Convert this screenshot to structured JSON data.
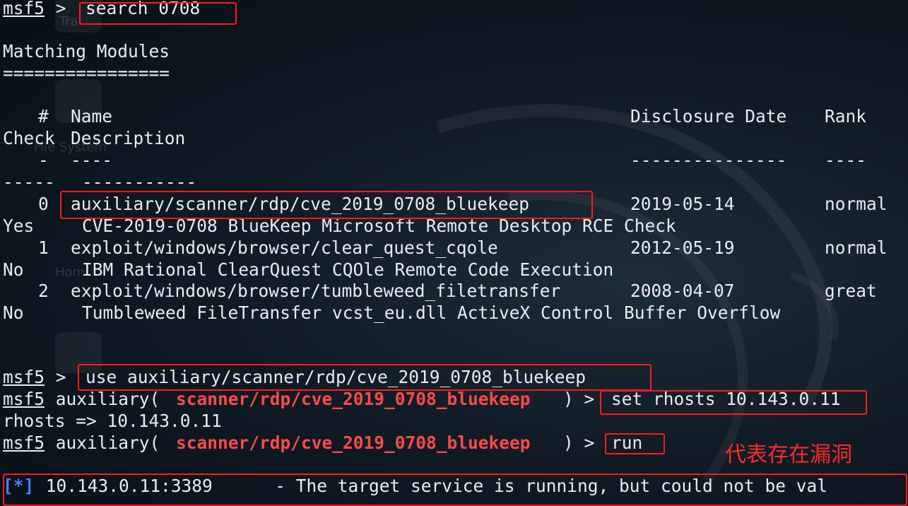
{
  "prompt": "msf5",
  "search": {
    "sep": " > ",
    "command": "search 0708"
  },
  "results": {
    "title": "Matching Modules",
    "underline": "================",
    "header_num": "#",
    "header_name": "Name",
    "header_date": "Disclosure Date",
    "header_rank": "Rank",
    "header_check": "Check",
    "header_desc": "Description",
    "dash_num": "-",
    "dash_name": "----",
    "dash_date": "---------------",
    "dash_rank": "----",
    "dash_check": "-----",
    "dash_desc": "-----------",
    "rows": [
      {
        "num": "0",
        "name": "auxiliary/scanner/rdp/cve_2019_0708_bluekeep",
        "date": "2019-05-14",
        "rank": "normal",
        "check": "Yes",
        "desc": "CVE-2019-0708 BlueKeep Microsoft Remote Desktop RCE Check"
      },
      {
        "num": "1",
        "name": "exploit/windows/browser/clear_quest_cqole",
        "date": "2012-05-19",
        "rank": "normal",
        "check": "No",
        "desc": "IBM Rational ClearQuest CQOle Remote Code Execution"
      },
      {
        "num": "2",
        "name": "exploit/windows/browser/tumbleweed_filetransfer",
        "date": "2008-04-07",
        "rank": "great",
        "check": "No",
        "desc": "Tumbleweed FileTransfer vcst_eu.dll ActiveX Control Buffer Overflow"
      }
    ]
  },
  "use_cmd": {
    "sep": " > ",
    "command": "use auxiliary/scanner/rdp/cve_2019_0708_bluekeep"
  },
  "set_cmd": {
    "pre": " auxiliary(",
    "module": "scanner/rdp/cve_2019_0708_bluekeep",
    "post": ") > ",
    "command": "set rhosts 10.143.0.11"
  },
  "set_output": "rhosts => 10.143.0.11",
  "run_cmd": {
    "pre": " auxiliary(",
    "module": "scanner/rdp/cve_2019_0708_bluekeep",
    "post": ") > ",
    "command": "run"
  },
  "result_line": {
    "tag": "[*]",
    "text": " 10.143.0.11:3389      - The target service is running, but could not be val"
  },
  "annotation": "代表存在漏洞",
  "background": {
    "ghost_labels": [
      "Tra",
      "File System",
      "Hom"
    ]
  },
  "colors": {
    "background": "#0c1620",
    "text": "#e9ecef",
    "module_red": "#ff4a4a",
    "tag_blue": "#4a7dff",
    "highlight_box": "#ff1a1a"
  }
}
